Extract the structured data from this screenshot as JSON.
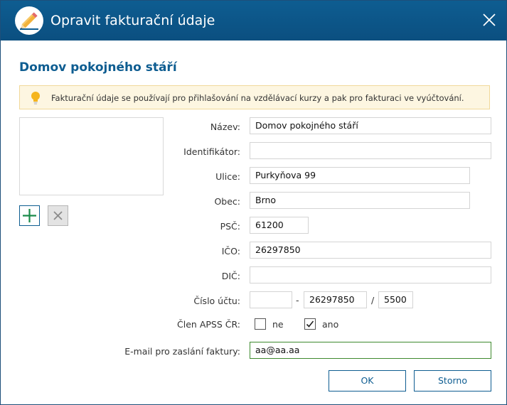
{
  "window": {
    "title": "Opravit fakturační údaje"
  },
  "heading": "Domov pokojného stáří",
  "info": {
    "text": "Fakturační údaje se používají pro přihlašování na vzdělávací kurzy a pak pro fakturaci ve vyúčtování."
  },
  "form": {
    "nazev": {
      "label": "Název:",
      "value": "Domov pokojného stáří"
    },
    "identifikator": {
      "label": "Identifikátor:",
      "value": ""
    },
    "ulice": {
      "label": "Ulice:",
      "value": "Purkyňova 99"
    },
    "obec": {
      "label": "Obec:",
      "value": "Brno"
    },
    "psc": {
      "label": "PSČ:",
      "value": "61200"
    },
    "ico": {
      "label": "IČO:",
      "value": "26297850"
    },
    "dic": {
      "label": "DIČ:",
      "value": ""
    },
    "cislo_uctu": {
      "label": "Číslo účtu:",
      "prefix": "",
      "separator_dash": "-",
      "number": "26297850",
      "separator_slash": "/",
      "bank_code": "5500"
    },
    "clen": {
      "label": "Člen APSS ČR:",
      "no_label": "ne",
      "no_checked": false,
      "yes_label": "ano",
      "yes_checked": true
    },
    "email": {
      "label": "E-mail pro zaslání faktury:",
      "value": "aa@aa.aa"
    }
  },
  "buttons": {
    "ok": "OK",
    "cancel": "Storno"
  },
  "icons": {
    "title": "pencil-edit-icon",
    "close": "close-icon",
    "info": "lightbulb-icon",
    "add": "plus-icon",
    "delete": "cross-icon",
    "check": "checkmark-icon"
  },
  "colors": {
    "titlebar": "#0b5a8e",
    "accent": "#0e5d91",
    "info_background": "#fdf6e1",
    "info_border": "#f1d99a",
    "focus_border": "#3e8a2e",
    "add_icon": "#1a8a4a"
  }
}
